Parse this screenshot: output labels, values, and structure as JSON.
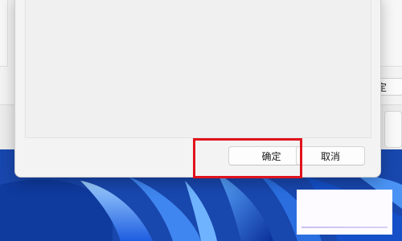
{
  "background_window": {
    "confirm_label": "定"
  },
  "dialog": {
    "ok_label": "确定",
    "cancel_label": "取消"
  },
  "colors": {
    "wallpaper": "#1b4fb5",
    "highlight": "#e0131c",
    "dialog_bg": "#f3f3f3"
  },
  "icons": {
    "wallpaper": "windows-bloom-wallpaper"
  }
}
